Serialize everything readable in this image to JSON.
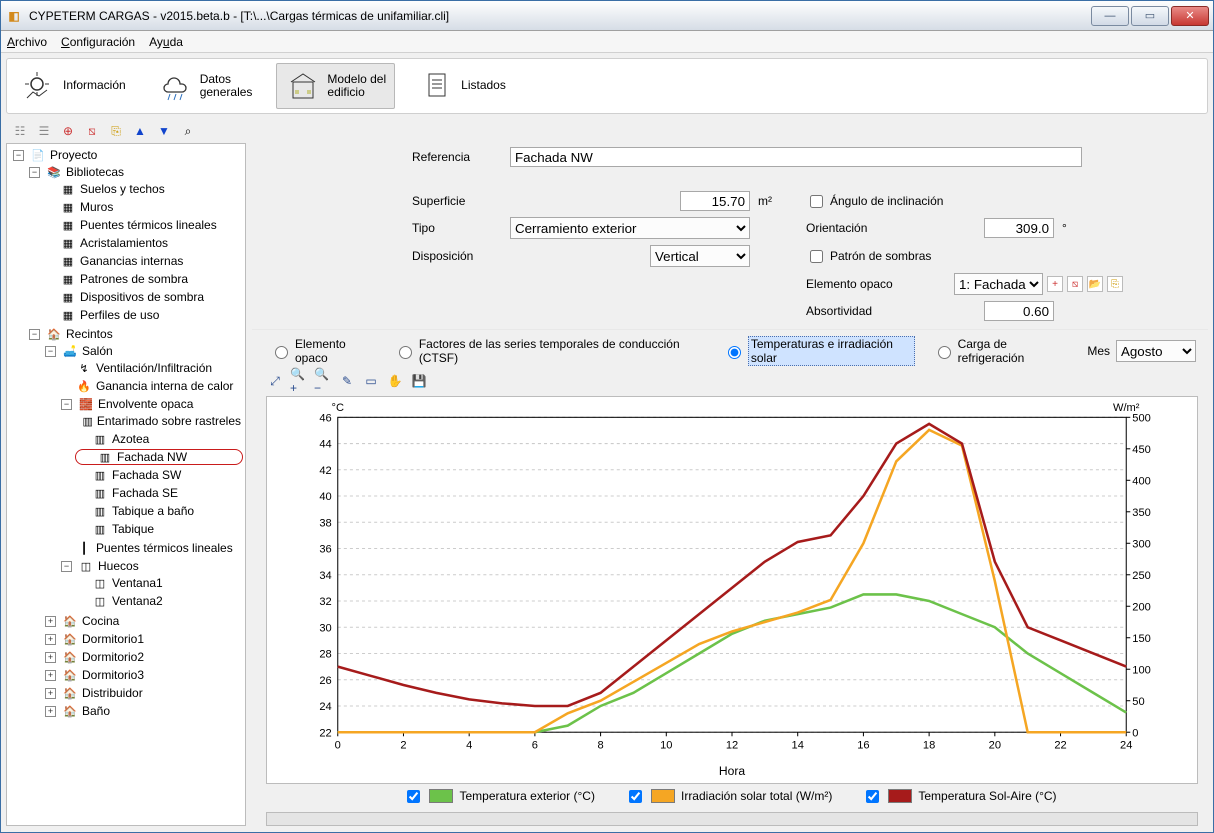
{
  "window": {
    "title": "CYPETERM CARGAS - v2015.beta.b - [T:\\...\\Cargas térmicas de unifamiliar.cli]"
  },
  "menu": {
    "archivo": "Archivo",
    "configuracion": "Configuración",
    "ayuda": "Ayuda"
  },
  "toolbar": {
    "info": "Información",
    "datos": "Datos\ngenerales",
    "modelo": "Modelo del\nedificio",
    "listados": "Listados"
  },
  "tree": {
    "root": "Proyecto",
    "biblio": "Bibliotecas",
    "biblio_items": [
      "Suelos y techos",
      "Muros",
      "Puentes térmicos lineales",
      "Acristalamientos",
      "Ganancias internas",
      "Patrones de sombra",
      "Dispositivos de sombra",
      "Perfiles de uso"
    ],
    "recintos": "Recintos",
    "salon": "Salón",
    "salon_items": [
      "Ventilación/Infiltración",
      "Ganancia interna de calor"
    ],
    "envolvente": "Envolvente opaca",
    "env_items": [
      "Entarimado sobre rastreles",
      "Azotea",
      "Fachada NW",
      "Fachada SW",
      "Fachada SE",
      "Tabique a baño",
      "Tabique"
    ],
    "ptl": "Puentes térmicos lineales",
    "huecos": "Huecos",
    "hueco_items": [
      "Ventana1",
      "Ventana2"
    ],
    "rest": [
      "Cocina",
      "Dormitorio1",
      "Dormitorio2",
      "Dormitorio3",
      "Distribuidor",
      "Baño"
    ]
  },
  "form": {
    "ref_label": "Referencia",
    "ref_value": "Fachada NW",
    "sup_label": "Superficie",
    "sup_value": "15.70",
    "sup_unit": "m²",
    "tipo_label": "Tipo",
    "tipo_value": "Cerramiento exterior",
    "disp_label": "Disposición",
    "disp_value": "Vertical",
    "ang_label": "Ángulo de inclinación",
    "orient_label": "Orientación",
    "orient_value": "309.0",
    "orient_unit": "°",
    "patron_label": "Patrón de sombras",
    "elop_label": "Elemento opaco",
    "elop_value": "1: Fachada",
    "abs_label": "Absortividad",
    "abs_value": "0.60"
  },
  "radios": {
    "r1": "Elemento opaco",
    "r2": "Factores de las series temporales de conducción (CTSF)",
    "r3": "Temperaturas e irradiación solar",
    "r4": "Carga de refrigeración",
    "mes_label": "Mes",
    "mes_value": "Agosto"
  },
  "legend": {
    "l1": "Temperatura exterior (°C)",
    "l2": "Irradiación solar total (W/m²)",
    "l3": "Temperatura Sol-Aire (°C)"
  },
  "chart_data": {
    "type": "line",
    "title": "",
    "xlabel": "Hora",
    "ylabel_left": "°C",
    "ylabel_right": "W/m²",
    "x": [
      0,
      1,
      2,
      3,
      4,
      5,
      6,
      7,
      8,
      9,
      10,
      11,
      12,
      13,
      14,
      15,
      16,
      17,
      18,
      19,
      20,
      21,
      22,
      23,
      24
    ],
    "ylim_left": [
      22,
      46
    ],
    "ylim_right": [
      0,
      500
    ],
    "yticks_left": [
      22,
      24,
      26,
      28,
      30,
      32,
      34,
      36,
      38,
      40,
      42,
      44,
      46
    ],
    "yticks_right": [
      0,
      50,
      100,
      150,
      200,
      250,
      300,
      350,
      400,
      450,
      500
    ],
    "xticks": [
      0,
      2,
      4,
      6,
      8,
      10,
      12,
      14,
      16,
      18,
      20,
      22,
      24
    ],
    "series": [
      {
        "name": "Temperatura exterior (°C)",
        "axis": "left",
        "color": "#6cc24a",
        "values": [
          22,
          22,
          22,
          22,
          22,
          22,
          22,
          22.5,
          24,
          25,
          26.5,
          28,
          29.5,
          30.5,
          31,
          31.5,
          32.5,
          32.5,
          32,
          31,
          30,
          28,
          26.5,
          25,
          23.5
        ]
      },
      {
        "name": "Irradiación solar total (W/m²)",
        "axis": "right",
        "color": "#f5a623",
        "values": [
          0,
          0,
          0,
          0,
          0,
          0,
          0,
          30,
          50,
          80,
          110,
          140,
          160,
          175,
          190,
          210,
          300,
          430,
          480,
          455,
          240,
          0,
          0,
          0,
          0
        ]
      },
      {
        "name": "Temperatura Sol-Aire (°C)",
        "axis": "left",
        "color": "#a61b1b",
        "values": [
          27,
          26.3,
          25.6,
          25,
          24.5,
          24.2,
          24,
          24,
          25,
          27,
          29,
          31,
          33,
          35,
          36.5,
          37,
          40,
          44,
          45.5,
          44,
          35,
          30,
          29,
          28,
          27
        ]
      }
    ]
  }
}
